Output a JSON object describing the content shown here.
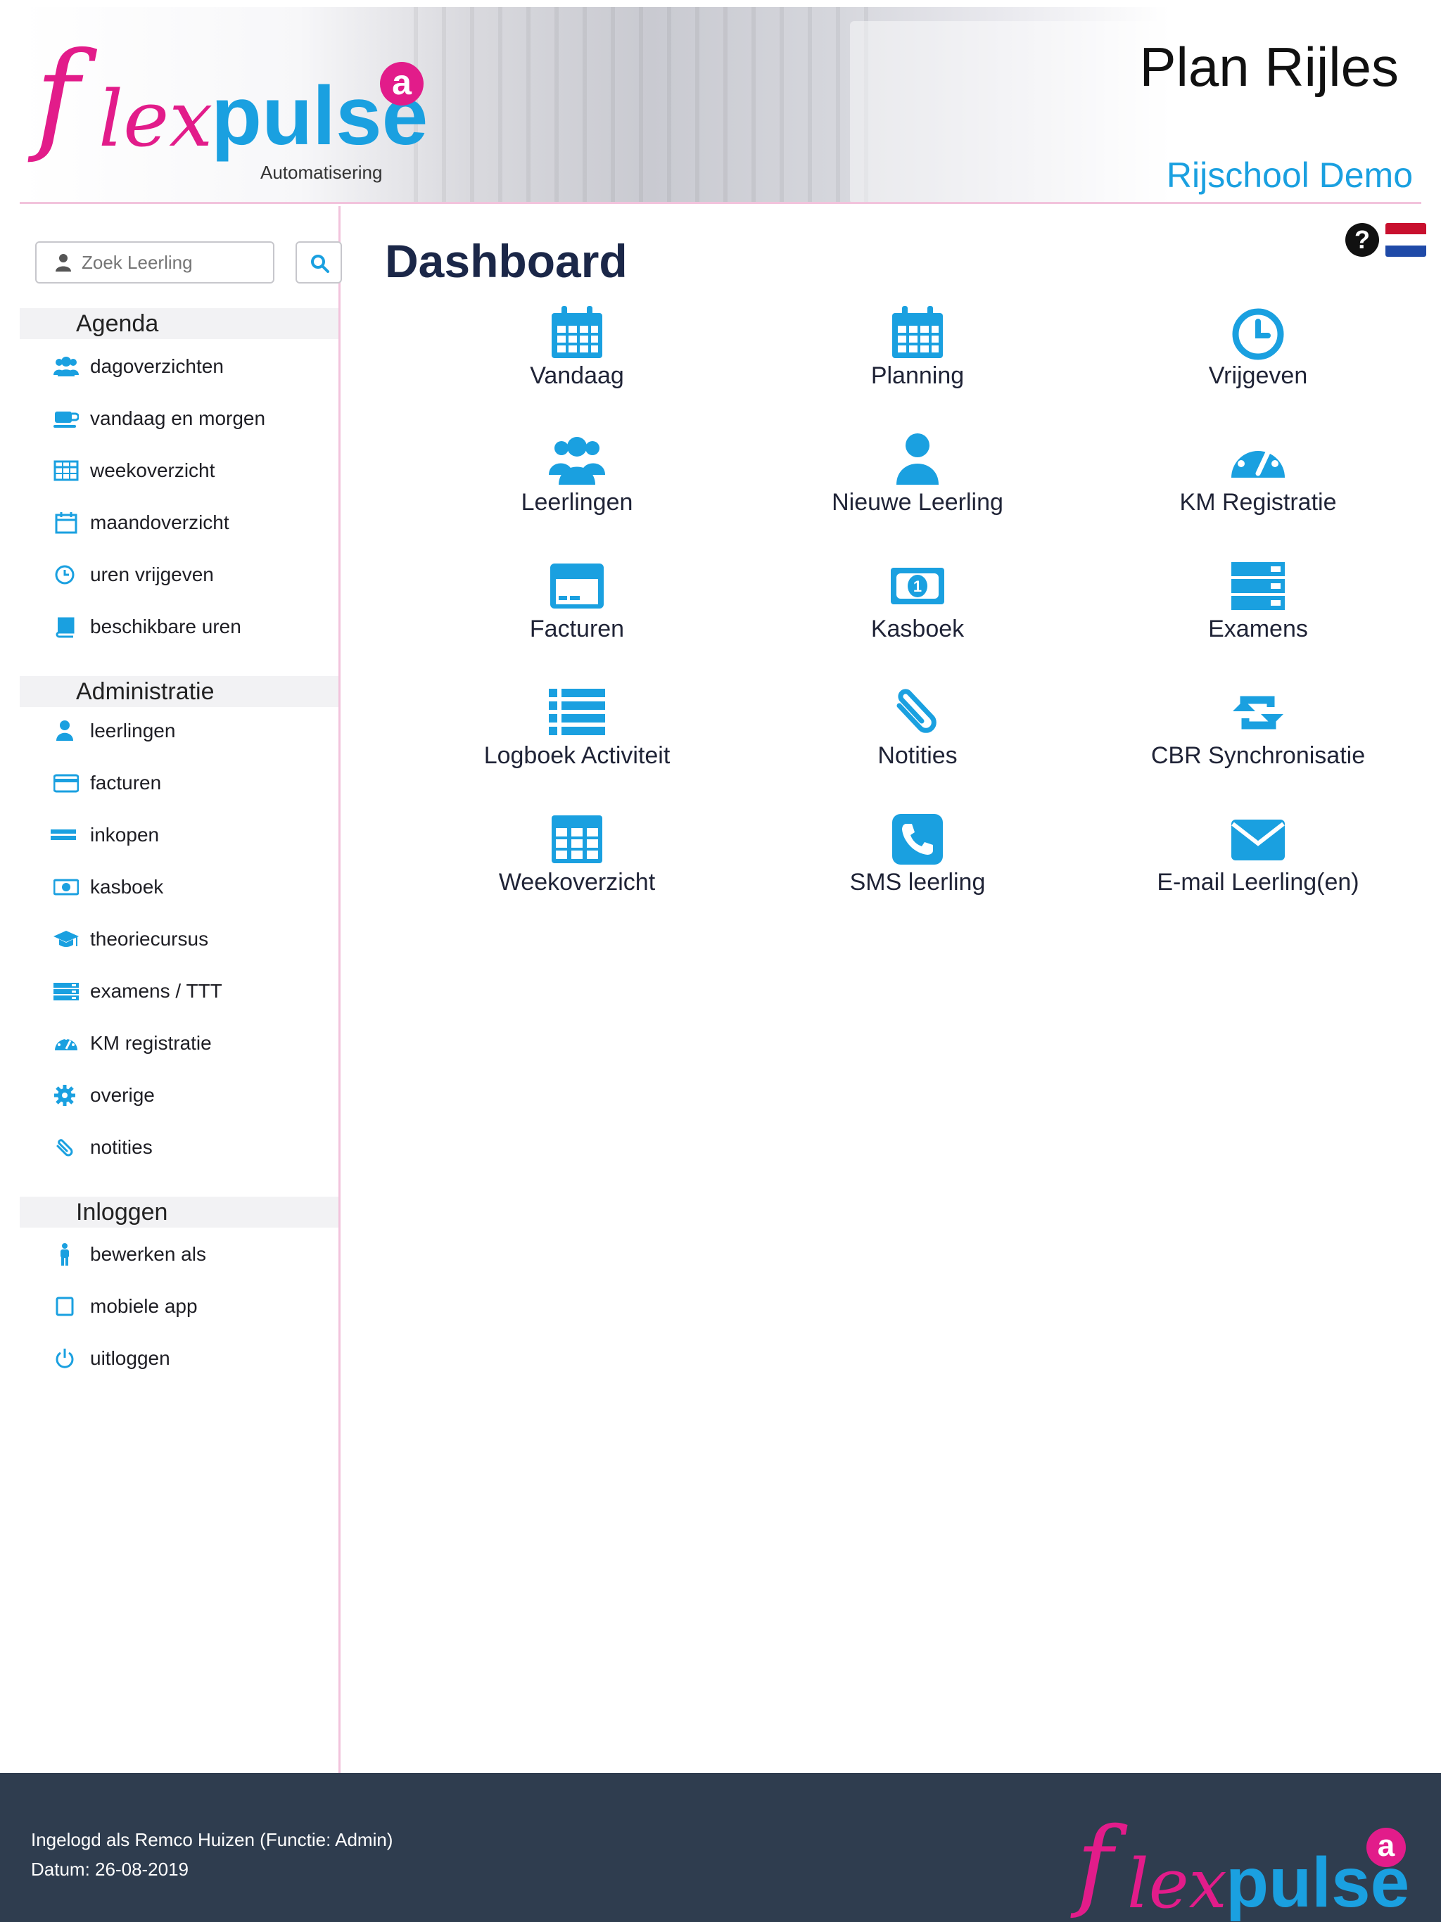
{
  "header": {
    "brand_f": "f",
    "brand_lex": "lex",
    "brand_pulse": "pulse",
    "brand_badge": "a",
    "brand_sub": "Automatisering",
    "app_title": "Plan Rijles",
    "school_name": "Rijschool Demo"
  },
  "search": {
    "placeholder": "Zoek Leerling"
  },
  "sidebar": {
    "sections": [
      {
        "title": "Agenda",
        "items": [
          {
            "label": "dagoverzichten",
            "icon": "users-icon"
          },
          {
            "label": "vandaag en morgen",
            "icon": "coffee-icon"
          },
          {
            "label": "weekoverzicht",
            "icon": "table-icon"
          },
          {
            "label": "maandoverzicht",
            "icon": "calendar-icon"
          },
          {
            "label": "uren vrijgeven",
            "icon": "clock-icon"
          },
          {
            "label": "beschikbare uren",
            "icon": "book-icon"
          }
        ]
      },
      {
        "title": "Administratie",
        "items": [
          {
            "label": "leerlingen",
            "icon": "user-icon"
          },
          {
            "label": "facturen",
            "icon": "credit-card-icon"
          },
          {
            "label": "inkopen",
            "icon": "bars-icon"
          },
          {
            "label": "kasboek",
            "icon": "money-icon"
          },
          {
            "label": "theoriecursus",
            "icon": "graduation-cap-icon"
          },
          {
            "label": "examens / TTT",
            "icon": "list-alt-icon"
          },
          {
            "label": "KM registratie",
            "icon": "dashboard-icon"
          },
          {
            "label": "overige",
            "icon": "gear-icon"
          },
          {
            "label": "notities",
            "icon": "paperclip-icon"
          }
        ]
      },
      {
        "title": "Inloggen",
        "items": [
          {
            "label": "bewerken als",
            "icon": "male-icon"
          },
          {
            "label": "mobiele app",
            "icon": "square-icon"
          },
          {
            "label": "uitloggen",
            "icon": "power-icon"
          }
        ]
      }
    ]
  },
  "main": {
    "title": "Dashboard",
    "help_glyph": "?",
    "tiles": [
      {
        "label": "Vandaag",
        "icon": "calendar-icon"
      },
      {
        "label": "Planning",
        "icon": "calendar-icon"
      },
      {
        "label": "Vrijgeven",
        "icon": "clock-icon"
      },
      {
        "label": "Leerlingen",
        "icon": "users-icon"
      },
      {
        "label": "Nieuwe Leerling",
        "icon": "user-icon"
      },
      {
        "label": "KM Registratie",
        "icon": "dashboard-icon"
      },
      {
        "label": "Facturen",
        "icon": "credit-card-icon"
      },
      {
        "label": "Kasboek",
        "icon": "money-icon"
      },
      {
        "label": "Examens",
        "icon": "list-alt-icon"
      },
      {
        "label": "Logboek Activiteit",
        "icon": "list-icon"
      },
      {
        "label": "Notities",
        "icon": "paperclip-icon"
      },
      {
        "label": "CBR Synchronisatie",
        "icon": "retweet-icon"
      },
      {
        "label": "Weekoverzicht",
        "icon": "table-icon"
      },
      {
        "label": "SMS leerling",
        "icon": "phone-icon"
      },
      {
        "label": "E-mail Leerling(en)",
        "icon": "envelope-icon"
      }
    ]
  },
  "footer": {
    "logged_in": "Ingelogd als Remco Huizen (Functie: Admin)",
    "date": "Datum: 26-08-2019",
    "brand_f": "f",
    "brand_lex": "lex",
    "brand_pulse": "pulse",
    "brand_badge": "a"
  },
  "colors": {
    "accent": "#1aa0e0",
    "brand_pink": "#e21c8a",
    "footer_bg": "#2f3d4f",
    "title_navy": "#1b2748"
  }
}
